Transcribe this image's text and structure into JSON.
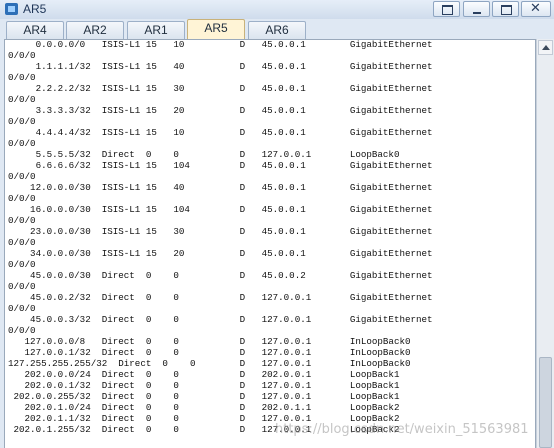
{
  "window": {
    "title": "AR5"
  },
  "tabs": [
    {
      "label": "AR4",
      "active": false
    },
    {
      "label": "AR2",
      "active": false
    },
    {
      "label": "AR1",
      "active": false
    },
    {
      "label": "AR5",
      "active": true
    },
    {
      "label": "AR6",
      "active": false
    }
  ],
  "console": {
    "text": "     0.0.0.0/0   ISIS-L1 15   10          D   45.0.0.1        GigabitEthernet\n0/0/0\n     1.1.1.1/32  ISIS-L1 15   40          D   45.0.0.1        GigabitEthernet\n0/0/0\n     2.2.2.2/32  ISIS-L1 15   30          D   45.0.0.1        GigabitEthernet\n0/0/0\n     3.3.3.3/32  ISIS-L1 15   20          D   45.0.0.1        GigabitEthernet\n0/0/0\n     4.4.4.4/32  ISIS-L1 15   10          D   45.0.0.1        GigabitEthernet\n0/0/0\n     5.5.5.5/32  Direct  0    0           D   127.0.0.1       LoopBack0\n     6.6.6.6/32  ISIS-L1 15   104         D   45.0.0.1        GigabitEthernet\n0/0/0\n    12.0.0.0/30  ISIS-L1 15   40          D   45.0.0.1        GigabitEthernet\n0/0/0\n    16.0.0.0/30  ISIS-L1 15   104         D   45.0.0.1        GigabitEthernet\n0/0/0\n    23.0.0.0/30  ISIS-L1 15   30          D   45.0.0.1        GigabitEthernet\n0/0/0\n    34.0.0.0/30  ISIS-L1 15   20          D   45.0.0.1        GigabitEthernet\n0/0/0\n    45.0.0.0/30  Direct  0    0           D   45.0.0.2        GigabitEthernet\n0/0/0\n    45.0.0.2/32  Direct  0    0           D   127.0.0.1       GigabitEthernet\n0/0/0\n    45.0.0.3/32  Direct  0    0           D   127.0.0.1       GigabitEthernet\n0/0/0\n   127.0.0.0/8   Direct  0    0           D   127.0.0.1       InLoopBack0\n   127.0.0.1/32  Direct  0    0           D   127.0.0.1       InLoopBack0\n127.255.255.255/32  Direct  0    0        D   127.0.0.1       InLoopBack0\n   202.0.0.0/24  Direct  0    0           D   202.0.0.1       LoopBack1\n   202.0.0.1/32  Direct  0    0           D   127.0.0.1       LoopBack1\n 202.0.0.255/32  Direct  0    0           D   127.0.0.1       LoopBack1\n   202.0.1.0/24  Direct  0    0           D   202.0.1.1       LoopBack2\n   202.0.1.1/32  Direct  0    0           D   127.0.0.1       LoopBack2\n 202.0.1.255/32  Direct  0    0           D   127.0.0.1       LoopBack2"
  },
  "watermark": {
    "text": "https://blog.csdn.net/weixin_51563981"
  },
  "colors": {
    "titlebar": "#cfdcec",
    "active_tab": "#fff4d6",
    "console_bg": "#ffffff"
  }
}
